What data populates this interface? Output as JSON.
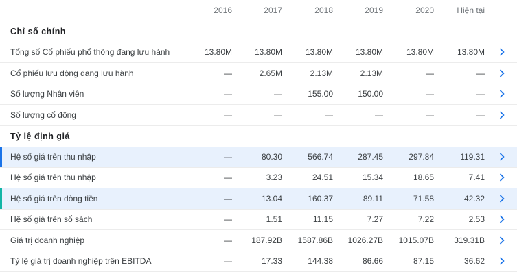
{
  "columns": [
    "2016",
    "2017",
    "2018",
    "2019",
    "2020",
    "Hiện tại"
  ],
  "sections": {
    "financial": "Chỉ số chính",
    "valuation": "Tỷ lệ định giá"
  },
  "rows": [
    {
      "label": "Tổng số Cổ phiếu phổ thông đang lưu hành",
      "values": [
        "13.80M",
        "13.80M",
        "13.80M",
        "13.80M",
        "13.80M",
        "13.80M"
      ]
    },
    {
      "label": "Cổ phiếu lưu động đang lưu hành",
      "values": [
        "—",
        "2.65M",
        "2.13M",
        "2.13M",
        "—",
        "—"
      ]
    },
    {
      "label": "Số lượng Nhân viên",
      "values": [
        "—",
        "—",
        "155.00",
        "150.00",
        "—",
        "—"
      ]
    },
    {
      "label": "Số lượng cổ đông",
      "values": [
        "—",
        "—",
        "—",
        "—",
        "—",
        "—"
      ]
    },
    {
      "label": "Hệ số giá trên thu nhập",
      "values": [
        "—",
        "80.30",
        "566.74",
        "287.45",
        "297.84",
        "119.31"
      ]
    },
    {
      "label": "Hệ số giá trên thu nhập",
      "values": [
        "—",
        "3.23",
        "24.51",
        "15.34",
        "18.65",
        "7.41"
      ]
    },
    {
      "label": "Hệ số giá trên dòng tiền",
      "values": [
        "—",
        "13.04",
        "160.37",
        "89.11",
        "71.58",
        "42.32"
      ]
    },
    {
      "label": "Hệ số giá trên sổ sách",
      "values": [
        "—",
        "1.51",
        "11.15",
        "7.27",
        "7.22",
        "2.53"
      ]
    },
    {
      "label": "Giá trị doanh nghiệp",
      "values": [
        "—",
        "187.92B",
        "1587.86B",
        "1026.27B",
        "1015.07B",
        "319.31B"
      ]
    },
    {
      "label": "Tỷ lệ giá trị doanh nghiệp trên EBITDA",
      "values": [
        "—",
        "17.33",
        "144.38",
        "86.66",
        "87.15",
        "36.62"
      ]
    }
  ],
  "colors": {
    "accent": "#1a73e8",
    "highlight_bg": "#e8f1fd",
    "teal_marker": "#12b5a6"
  },
  "icons": {
    "row_action": "chevron-right-icon"
  }
}
